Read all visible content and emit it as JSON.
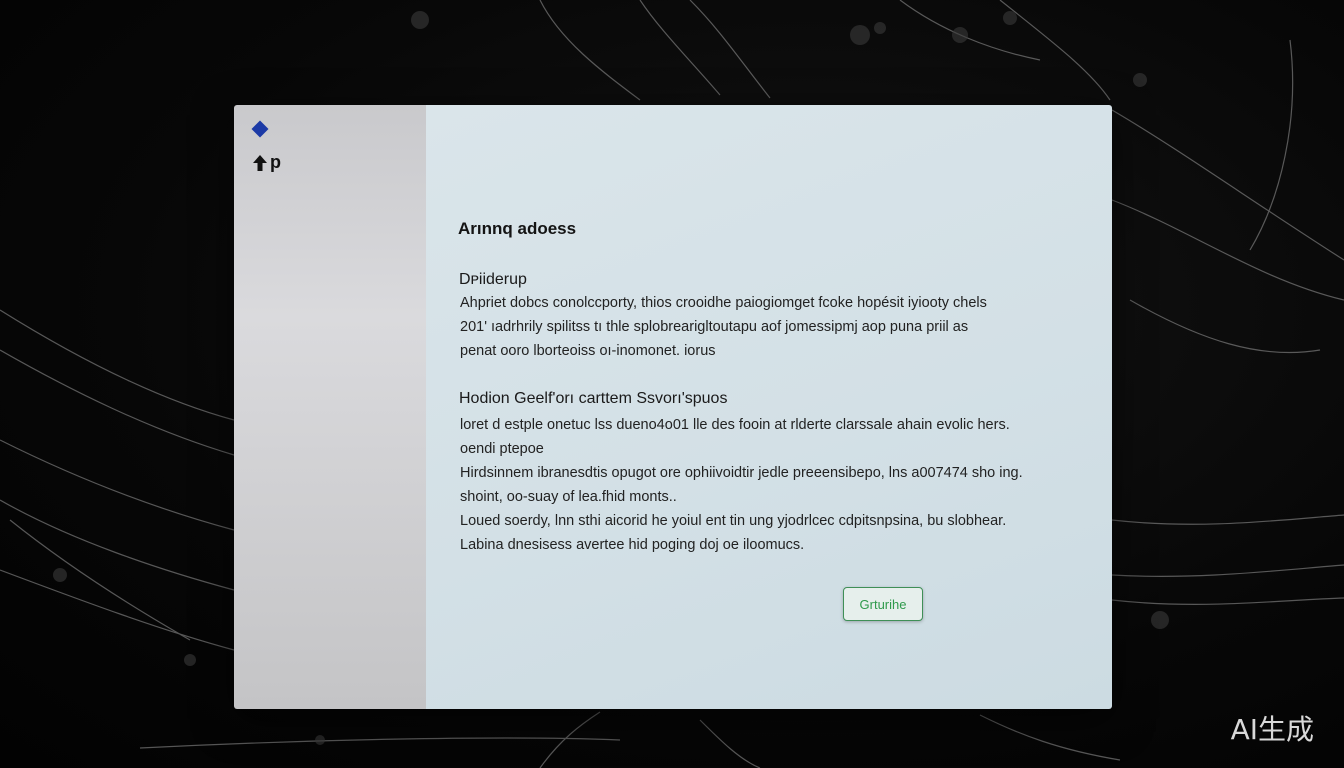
{
  "dialog": {
    "heading": "Arınnq adoess",
    "section1": {
      "title": "Dᴘiiderup",
      "lines": [
        "Ahpriet dobcs conolccporty, thios cr͏oo͏idhe paiogiomget fcoke hopésit iyiooty chels",
        "201' ıadrhrily spilitss tı thle splobrearigltoutapu aof jomessipmj aop͏ puna priil as",
        "penat ooro lborteoiss oı-inomonet. iorus"
      ]
    },
    "section2": {
      "title": "Hodion Geelf'orı carttem Ssvorı'spuos",
      "paragraphs": [
        [
          "loret d estple onetuc lss dueno4o01 lle des fooin at rlderte clarssale ahain evolic hers.",
          "oendi ptepoe"
        ],
        [
          "Hirdsinnem ibranesdtis opugot ore ophiivoidtir jedle preeensibepo, lns a007474 sho ing.",
          "shoint, oo-suay of lea.fhid monts.."
        ],
        [
          "Loued soer͏dy, lnn sthi aicorid he yoiul ent tin ung yjodrlcec cdpitsnpsina, bu slobhear.",
          "Labina dnesisess avertee hid poging doj oe iloomucs."
        ]
      ]
    },
    "button_label": "Grturihe"
  },
  "watermark": "AI生成",
  "colors": {
    "accent": "#1c3aa6",
    "button_text": "#2f9a4c",
    "button_border": "#3f8f57"
  },
  "icons": {
    "logo": "diamond-logo-icon",
    "app_mark_arrow": "arrow-up-icon"
  }
}
